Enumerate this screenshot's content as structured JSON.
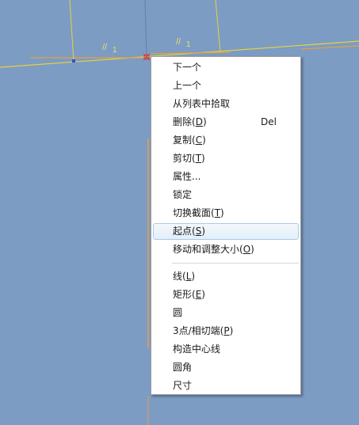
{
  "colors": {
    "background": "#7c9cc4",
    "sketch_line": "#e8d23a",
    "construction_line": "#e8a040",
    "menu_bg": "#ffffff",
    "highlight_border": "#aac9e8"
  },
  "canvas": {
    "constraint_marks": [
      "//",
      "1",
      "//",
      "1"
    ]
  },
  "context_menu": {
    "items": [
      {
        "label": "下一个"
      },
      {
        "label": "上一个"
      },
      {
        "label": "从列表中拾取"
      },
      {
        "label": "删除(D)",
        "shortcut": "Del"
      },
      {
        "label": "复制(C)"
      },
      {
        "label": "剪切(T)"
      },
      {
        "label": "属性..."
      },
      {
        "label": "锁定"
      },
      {
        "label": "切换截面(T)"
      },
      {
        "label": "起点(S)",
        "highlighted": true
      },
      {
        "label": "移动和调整大小(O)"
      },
      {
        "label": "线(L)"
      },
      {
        "label": "矩形(E)"
      },
      {
        "label": "圆"
      },
      {
        "label": "3点/相切端(P)"
      },
      {
        "label": "构造中心线"
      },
      {
        "label": "圆角"
      },
      {
        "label": "尺寸"
      }
    ]
  }
}
